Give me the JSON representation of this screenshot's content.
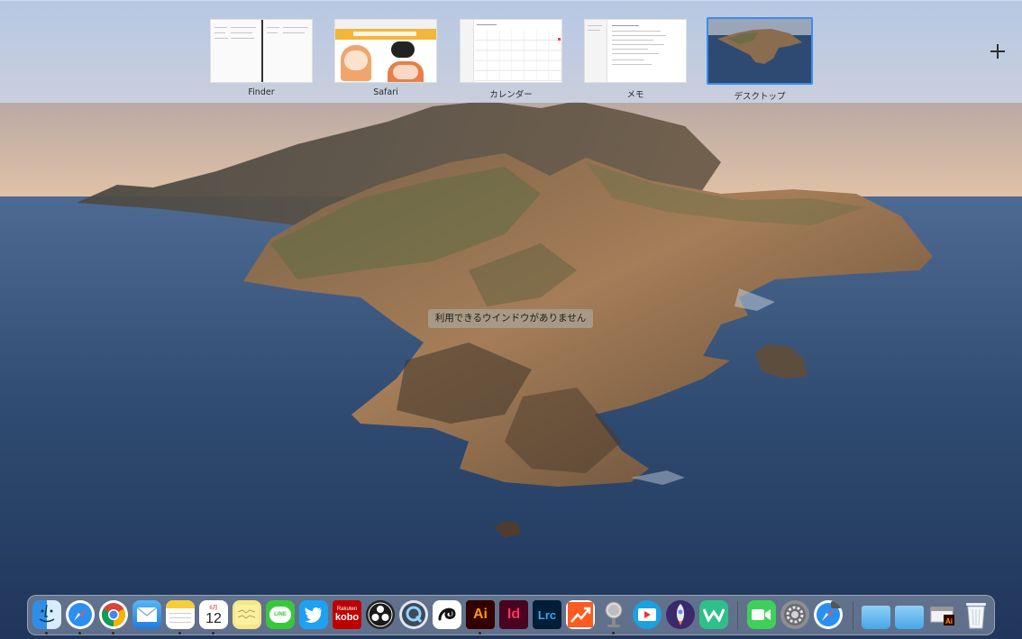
{
  "mission_control": {
    "spaces": [
      {
        "label": "Finder",
        "selected": false
      },
      {
        "label": "Safari",
        "selected": false
      },
      {
        "label": "カレンダー",
        "selected": false
      },
      {
        "label": "メモ",
        "selected": false
      },
      {
        "label": "デスクトップ",
        "selected": true
      }
    ],
    "add_space_icon": "plus-icon"
  },
  "desktop": {
    "message": "利用できるウインドウがありません"
  },
  "calendar_icon": {
    "month": "6月",
    "day": "12"
  },
  "dock": {
    "apps": [
      {
        "name": "Finder",
        "icon": "finder-icon",
        "running": true
      },
      {
        "name": "Safari",
        "icon": "safari-icon",
        "running": true
      },
      {
        "name": "Google Chrome",
        "icon": "chrome-icon",
        "running": true
      },
      {
        "name": "Mail",
        "icon": "mail-icon",
        "running": false
      },
      {
        "name": "Notes",
        "icon": "notes-icon",
        "running": true
      },
      {
        "name": "Calendar",
        "icon": "calendar-icon",
        "running": true
      },
      {
        "name": "Stickies",
        "icon": "stickies-icon",
        "running": false
      },
      {
        "name": "LINE",
        "icon": "line-icon",
        "running": false
      },
      {
        "name": "Twitter",
        "icon": "twitter-icon",
        "running": false
      },
      {
        "name": "Rakuten Kobo",
        "icon": "kobo-icon",
        "running": false
      },
      {
        "name": "OBS",
        "icon": "obs-icon",
        "running": false
      },
      {
        "name": "QuickTime",
        "icon": "quicktime-icon",
        "running": false
      },
      {
        "name": "Clip Studio",
        "icon": "clip-studio-icon",
        "running": false
      },
      {
        "name": "Illustrator",
        "icon": "illustrator-icon",
        "running": true
      },
      {
        "name": "InDesign",
        "icon": "indesign-icon",
        "running": false
      },
      {
        "name": "Lightroom Classic",
        "icon": "lightroom-icon",
        "running": false
      },
      {
        "name": "Analytics",
        "icon": "chart-arrow-icon",
        "running": false
      },
      {
        "name": "Microphone",
        "icon": "microphone-icon",
        "running": true
      },
      {
        "name": "Video",
        "icon": "video-icon",
        "running": false
      },
      {
        "name": "Rocket",
        "icon": "rocket-icon",
        "running": false
      },
      {
        "name": "Altair",
        "icon": "w-logo-icon",
        "running": false
      },
      {
        "name": "FaceTime",
        "icon": "facetime-icon",
        "running": false
      },
      {
        "name": "System Preferences",
        "icon": "gear-icon",
        "running": false
      },
      {
        "name": "Safari Technology",
        "icon": "safari-preview-icon",
        "running": false
      },
      {
        "name": "Folder",
        "icon": "folder-icon",
        "running": false
      },
      {
        "name": "Folder",
        "icon": "folder-icon",
        "running": false
      },
      {
        "name": "Illustrator Document",
        "icon": "ai-document-icon",
        "running": false
      },
      {
        "name": "Trash",
        "icon": "trash-icon",
        "running": false
      }
    ],
    "labels": {
      "kobo_top": "Rakuten",
      "kobo_bottom": "kobo",
      "ai": "Ai",
      "id": "Id",
      "lrc": "Lrc",
      "line": "LINE"
    }
  }
}
